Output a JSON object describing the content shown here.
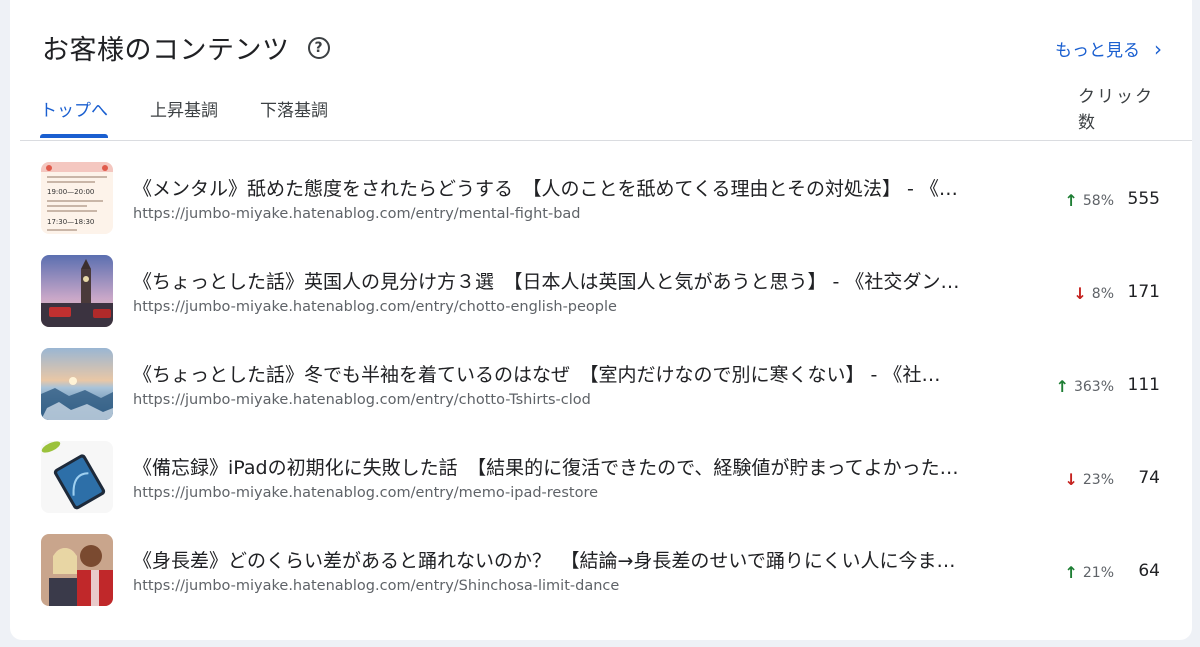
{
  "header": {
    "title": "お客様のコンテンツ",
    "help_icon": "help-circle-icon",
    "more_label": "もっと見る",
    "more_icon": "chevron-right-icon",
    "accent_color": "#1a5fd0"
  },
  "tabs": [
    {
      "label": "トップへ",
      "active": true
    },
    {
      "label": "上昇基調",
      "active": false
    },
    {
      "label": "下落基調",
      "active": false
    }
  ],
  "column_header": "クリック数",
  "rows": [
    {
      "title": "《メンタル》舐めた態度をされたらどうする　【人のことを舐めてくる理由とその対処法】 - 《…",
      "url": "https://jumbo-miyake.hatenablog.com/entry/mental-fight-bad",
      "trend": "up",
      "trend_icon": "arrow-up-icon",
      "change": "58%",
      "clicks": "555",
      "thumb_text": [
        "19:00—20:00",
        "17:30—18:30"
      ]
    },
    {
      "title": "《ちょっとした話》英国人の見分け方３選　【日本人は英国人と気があうと思う】 - 《社交ダン…",
      "url": "https://jumbo-miyake.hatenablog.com/entry/chotto-english-people",
      "trend": "down",
      "trend_icon": "arrow-down-icon",
      "change": "8%",
      "clicks": "171"
    },
    {
      "title": "《ちょっとした話》冬でも半袖を着ているのはなぜ　【室内だけなので別に寒くない】 - 《社…",
      "url": "https://jumbo-miyake.hatenablog.com/entry/chotto-Tshirts-clod",
      "trend": "up",
      "trend_icon": "arrow-up-icon",
      "change": "363%",
      "clicks": "111"
    },
    {
      "title": "《備忘録》iPadの初期化に失敗した話　【結果的に復活できたので、経験値が貯まってよかった…",
      "url": "https://jumbo-miyake.hatenablog.com/entry/memo-ipad-restore",
      "trend": "down",
      "trend_icon": "arrow-down-icon",
      "change": "23%",
      "clicks": "74"
    },
    {
      "title": "《身長差》どのくらい差があると踊れないのか？　【結論→身長差のせいで踊りにくい人に今ま…",
      "url": "https://jumbo-miyake.hatenablog.com/entry/Shinchosa-limit-dance",
      "trend": "up",
      "trend_icon": "arrow-up-icon",
      "change": "21%",
      "clicks": "64"
    }
  ]
}
